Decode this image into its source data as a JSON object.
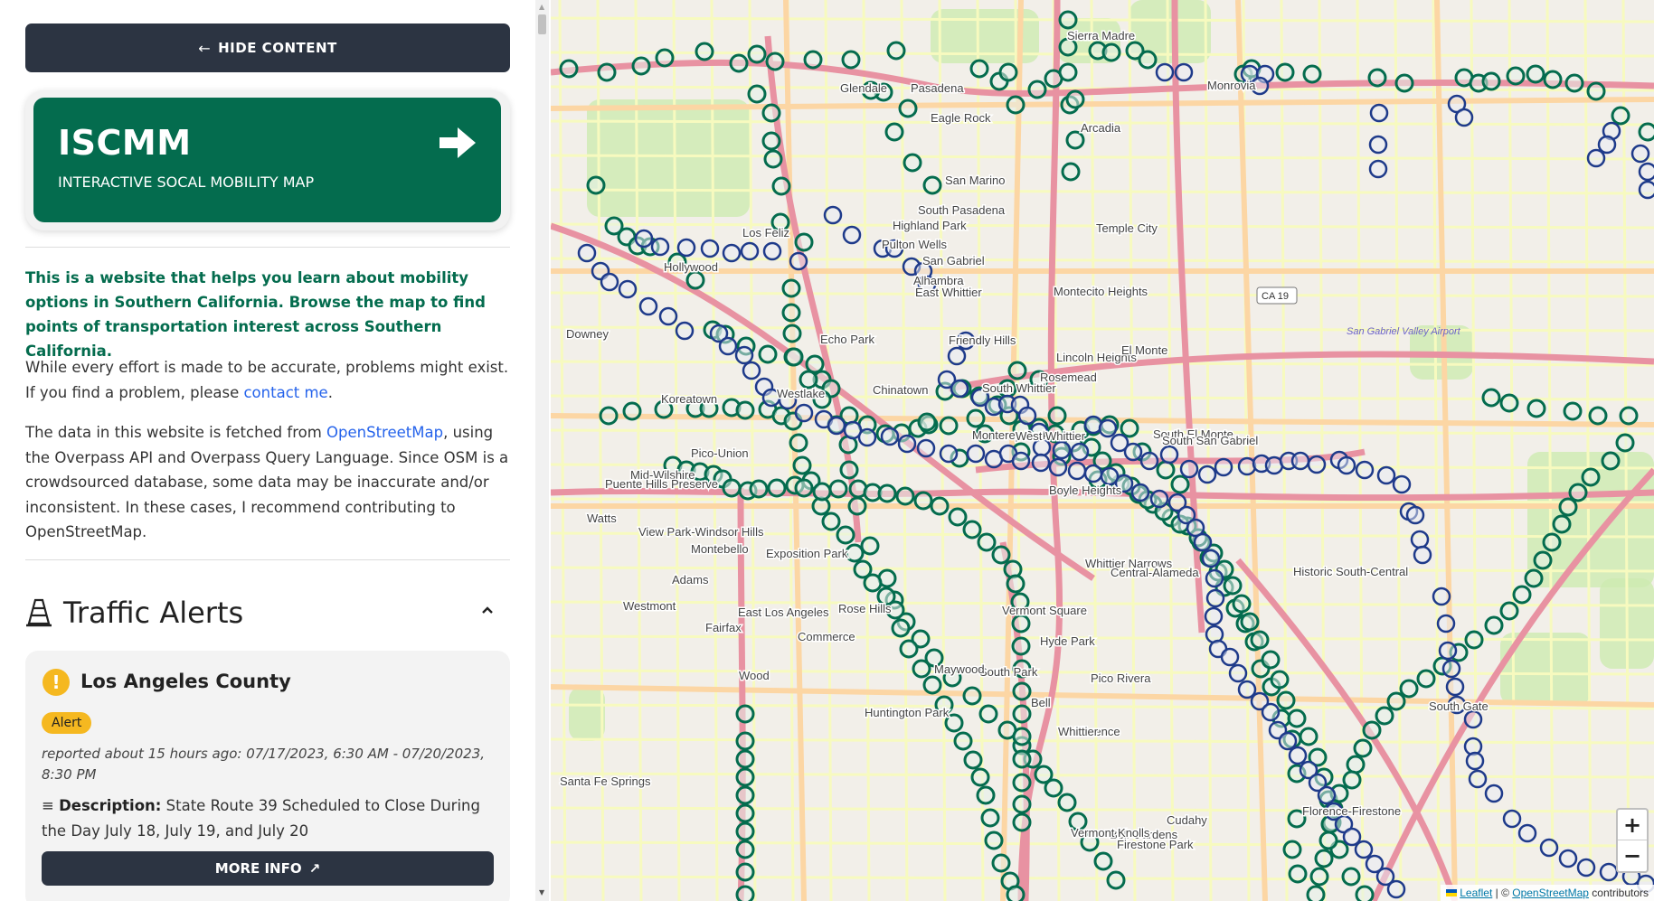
{
  "sidebar": {
    "hide_button": "HIDE CONTENT",
    "hero": {
      "title": "ISCMM",
      "subtitle": "INTERACTIVE SOCAL MOBILITY MAP"
    },
    "intro": "This is a website that helps you learn about mobility options in Southern California. Browse the map to find points of transportation interest across Southern California.",
    "accuracy": {
      "text": "While every effort is made to be accurate, problems might exist. If you find a problem, please ",
      "link": "contact me",
      "after": "."
    },
    "data_source": {
      "before": "The data in this website is fetched from ",
      "link": "OpenStreetMap",
      "after": ", using the Overpass API and Overpass Query Language. Since OSM is a crowdsourced database, some data may be inaccurate and/or inconsistent. In these cases, I recommend contributing to OpenStreetMap."
    },
    "alerts": {
      "heading": "Traffic Alerts",
      "card": {
        "county": "Los Angeles County",
        "badge": "Alert",
        "reported": "reported about 15 hours ago: 07/17/2023, 6:30 AM - 07/20/2023, 8:30 PM",
        "desc_label": "Description:",
        "desc_text": "State Route 39 Scheduled to Close During the Day July 18, July 19, and July 20",
        "more_button": "MORE INFO"
      }
    }
  },
  "map": {
    "colors": {
      "exit_marker": "#046c4e",
      "station_marker": "#1e3a8a",
      "freeway": "#e892a2",
      "primary": "#fcd6a4",
      "secondary": "#f7fabf",
      "park": "#cdebb0",
      "base": "#f2efe9"
    },
    "place_labels": [
      "Glendale",
      "Eagle Rock",
      "Pasadena",
      "Sierra Madre",
      "Monrovia",
      "Arcadia",
      "San Marino",
      "Temple City",
      "South Pasadena",
      "Highland Park",
      "Los Feliz",
      "Hollywood",
      "Montecito Heights",
      "Alhambra",
      "San Gabriel",
      "Echo Park",
      "Lincoln Heights",
      "Koreatown",
      "Westlake",
      "Chinatown",
      "Monterey Park",
      "Rosemead",
      "El Monte",
      "South El Monte",
      "South San Gabriel",
      "Pico-Union",
      "Mid-Wilshire",
      "Boyle Heights",
      "Whittier Narrows",
      "Montebello",
      "Exposition Park",
      "Historic South-Central",
      "East Los Angeles",
      "Rose Hills",
      "Vermont Square",
      "Central-Alameda",
      "Commerce",
      "Hyde Park",
      "South Park",
      "Maywood",
      "Huntington Park",
      "Pico Rivera",
      "Bell",
      "Florence",
      "Bell Gardens",
      "Whittier",
      "Vermont Knolls",
      "Florence-Firestone",
      "Firestone Park",
      "Cudahy",
      "South Gate",
      "Westmont",
      "Watts",
      "Downey",
      "Santa Fe Springs",
      "Pulton Wells",
      "East Whittier",
      "Friendly Hills",
      "South Whittier",
      "West Whittier",
      "Puente Hills Preserve",
      "View Park-Windsor Hills",
      "Adams",
      "Fairfax",
      "Wood"
    ],
    "shield_label": "CA 19",
    "airport_label": "San Gabriel Valley Airport",
    "zoom_in": "+",
    "zoom_out": "−",
    "attribution": {
      "leaflet": "Leaflet",
      "sep": " | © ",
      "osm": "OpenStreetMap",
      "tail": " contributors"
    }
  }
}
